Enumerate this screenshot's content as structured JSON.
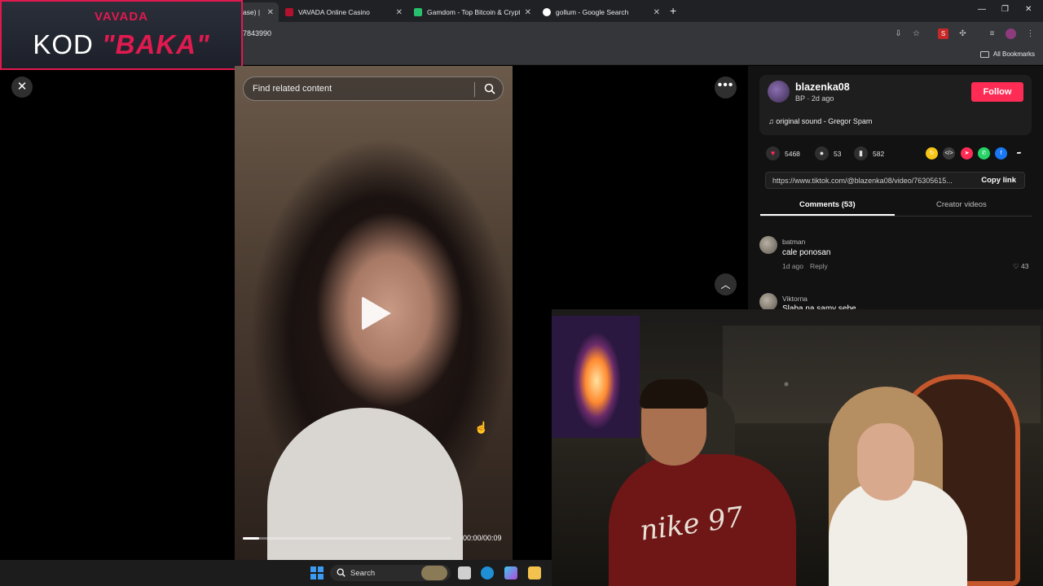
{
  "browser": {
    "tabs": [
      {
        "title": "ase) |",
        "active": true
      },
      {
        "title": "VAVADA Online Casino",
        "active": false
      },
      {
        "title": "Gamdom - Top Bitcoin & Crypt",
        "active": false
      },
      {
        "title": "gollum - Google Search",
        "active": false
      }
    ],
    "url": "7843990",
    "bookmarks_label": "All Bookmarks"
  },
  "promo": {
    "brand": "VAVADA",
    "code_prefix": "KOD ",
    "code_value": "\"BAKA\""
  },
  "video": {
    "search_placeholder": "Find related content",
    "time": "00:00/00:09",
    "progress": 0.08
  },
  "author": {
    "username": "blazenka08",
    "meta": "BP · 2d ago",
    "follow_label": "Follow",
    "music": "original sound - Gregor Spam"
  },
  "stats": {
    "likes": "5468",
    "comments": "53",
    "saves": "582"
  },
  "share": {
    "link": "https://www.tiktok.com/@blazenka08/video/76305615...",
    "copy_label": "Copy link"
  },
  "tabs": {
    "comments": "Comments (53)",
    "creator": "Creator videos"
  },
  "comments": [
    {
      "user": "batman",
      "text": "cale ponosan",
      "time": "1d ago",
      "reply": "Reply",
      "likes": "43"
    },
    {
      "user": "Viktorпа",
      "text": "Slaba na samy sebe",
      "time": "",
      "reply": "",
      "likes": ""
    }
  ],
  "taskbar": {
    "search": "Search"
  },
  "webcam": {
    "shirt_text": "nike 97"
  },
  "colors": {
    "accent": "#fe2c55",
    "promo_red": "#e01a4f"
  }
}
